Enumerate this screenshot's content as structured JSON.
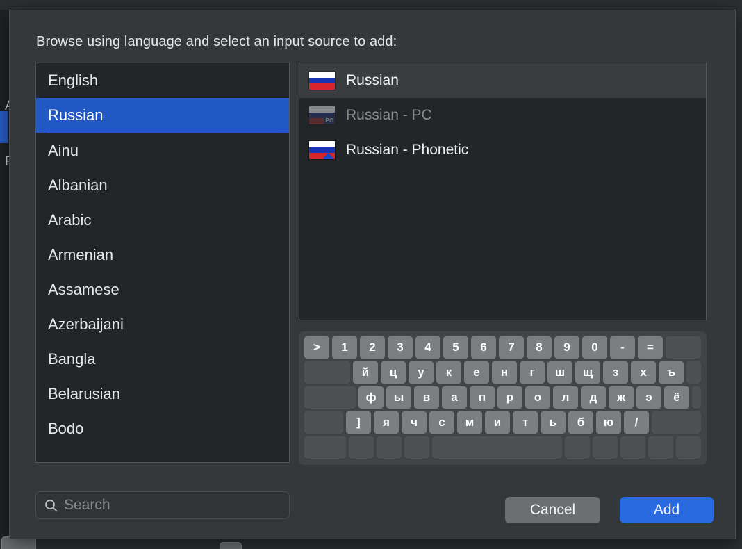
{
  "dialog": {
    "prompt": "Browse using language and select an input source to add:"
  },
  "language_list": {
    "recent": [
      {
        "label": "English",
        "selected": false
      },
      {
        "label": "Russian",
        "selected": true
      }
    ],
    "all": [
      {
        "label": "Ainu"
      },
      {
        "label": "Albanian"
      },
      {
        "label": "Arabic"
      },
      {
        "label": "Armenian"
      },
      {
        "label": "Assamese"
      },
      {
        "label": "Azerbaijani"
      },
      {
        "label": "Bangla"
      },
      {
        "label": "Belarusian"
      },
      {
        "label": "Bodo"
      }
    ]
  },
  "input_sources": [
    {
      "label": "Russian",
      "flag": "russia-flag-icon",
      "state": "active"
    },
    {
      "label": "Russian - PC",
      "flag": "russia-pc-flag-icon",
      "state": "dimmed"
    },
    {
      "label": "Russian - Phonetic",
      "flag": "russia-phonetic-flag-icon",
      "state": "normal"
    }
  ],
  "keyboard_preview": {
    "layout_name": "Russian",
    "rows": [
      [
        {
          "label": ">",
          "w": "k-w0"
        },
        {
          "label": "1"
        },
        {
          "label": "2"
        },
        {
          "label": "3"
        },
        {
          "label": "4"
        },
        {
          "label": "5"
        },
        {
          "label": "6"
        },
        {
          "label": "7"
        },
        {
          "label": "8"
        },
        {
          "label": "9"
        },
        {
          "label": "0"
        },
        {
          "label": "-"
        },
        {
          "label": "=",
          "w": "k-w0"
        },
        {
          "label": "",
          "w": "k-grow",
          "blank": true
        }
      ],
      [
        {
          "label": "",
          "w": "k-w18",
          "blank": true
        },
        {
          "label": "й"
        },
        {
          "label": "ц"
        },
        {
          "label": "у"
        },
        {
          "label": "к"
        },
        {
          "label": "е"
        },
        {
          "label": "н"
        },
        {
          "label": "г"
        },
        {
          "label": "ш"
        },
        {
          "label": "щ"
        },
        {
          "label": "з"
        },
        {
          "label": "х"
        },
        {
          "label": "ъ"
        },
        {
          "label": "",
          "w": "k-grow",
          "blank": true
        }
      ],
      [
        {
          "label": "",
          "w": "k-w20",
          "blank": true
        },
        {
          "label": "ф"
        },
        {
          "label": "ы"
        },
        {
          "label": "в"
        },
        {
          "label": "а"
        },
        {
          "label": "п"
        },
        {
          "label": "р"
        },
        {
          "label": "о"
        },
        {
          "label": "л"
        },
        {
          "label": "д"
        },
        {
          "label": "ж"
        },
        {
          "label": "э"
        },
        {
          "label": "ё"
        },
        {
          "label": "",
          "w": "k-grow",
          "blank": true
        }
      ],
      [
        {
          "label": "",
          "w": "k-w15",
          "blank": true
        },
        {
          "label": "]"
        },
        {
          "label": "я"
        },
        {
          "label": "ч"
        },
        {
          "label": "с"
        },
        {
          "label": "м"
        },
        {
          "label": "и"
        },
        {
          "label": "т"
        },
        {
          "label": "ь"
        },
        {
          "label": "б"
        },
        {
          "label": "ю"
        },
        {
          "label": "/"
        },
        {
          "label": "",
          "w": "k-grow",
          "blank": true
        }
      ],
      [
        {
          "label": "",
          "w": "k-w16",
          "blank": true
        },
        {
          "label": "",
          "w": "k-w0",
          "blank": true
        },
        {
          "label": "",
          "w": "k-w0",
          "blank": true
        },
        {
          "label": "",
          "w": "k-w0",
          "blank": true
        },
        {
          "label": "",
          "w": "k-space",
          "blank": true
        },
        {
          "label": "",
          "w": "k-w0",
          "blank": true
        },
        {
          "label": "",
          "w": "k-w0",
          "blank": true
        },
        {
          "label": "",
          "w": "k-w0",
          "blank": true
        },
        {
          "label": "",
          "w": "k-w0",
          "arrows": true
        },
        {
          "label": "",
          "w": "k-w0",
          "blank": true
        }
      ]
    ]
  },
  "search": {
    "placeholder": "Search",
    "value": "",
    "icon": "search-icon"
  },
  "actions": {
    "cancel_label": "Cancel",
    "add_label": "Add"
  },
  "colors": {
    "accent": "#2258c4",
    "add_button": "#2a6ae0",
    "cancel_button": "#6c6f72",
    "panel_bg": "#232629",
    "sheet_bg": "#35383b",
    "key": "#7c7f82",
    "key_blank": "#4e5154"
  },
  "background_window": {
    "rows": [
      "A",
      "F"
    ]
  }
}
